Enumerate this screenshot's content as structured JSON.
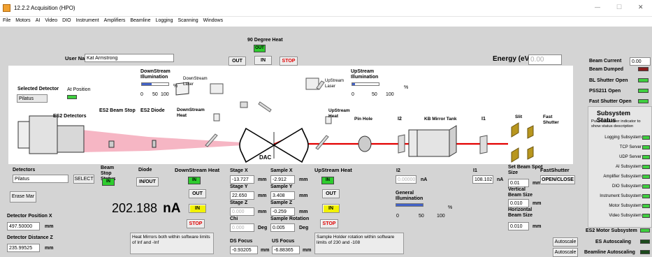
{
  "window": {
    "title": "12.2.2 Acquisition (HPO)",
    "minimize": "—",
    "maximize": "☐",
    "close": "✕"
  },
  "menu": [
    "File",
    "Motors",
    "AI",
    "Video",
    "DIO",
    "Instrument",
    "Amplifiers",
    "Beamline",
    "Logging",
    "Scanning",
    "Windows"
  ],
  "header": {
    "user_name_label": "User Name",
    "user_name": "Kat Armstrong",
    "heat90_label": "90 Degree Heat",
    "heat90_state": "OUT",
    "out": "OUT",
    "in": "IN",
    "stop": "STOP",
    "energy_label": "Energy (eV)",
    "energy_value": "0.00"
  },
  "right_status": {
    "beam_current_label": "Beam Current",
    "beam_current": "0.00",
    "beam_dumped": "Beam Dumped",
    "bl_shutter": "BL Shutter Open",
    "pss211": "PSS211 Open",
    "fast_shutter": "Fast Shutter Open"
  },
  "subsystem": {
    "title": "Subsystem Status",
    "hint": "Put mouse over indicator to show status description",
    "items": [
      "Logging Subsystem",
      "TCP Server",
      "UDP Server",
      "AI Subsystem",
      "Amplifier Subsystem",
      "DIO Subsystem",
      "Instrument Subsystem",
      "Motor Subsystem",
      "Video Subsystem"
    ]
  },
  "bottom_right": {
    "es2_motor": "ES2 Motor Subsystem",
    "es_autoscaling": "ES Autoscaling",
    "bl_autoscaling": "Beamline Autoscaling",
    "autoscale": "Autoscale"
  },
  "diagram": {
    "selected_detector_label": "Selected Detector",
    "selected_detector": "Pilatus",
    "at_position": "At Position",
    "downstream_illumination": "DownStream Illumination",
    "upstream_illumination": "UpStream Illumination",
    "pct": "%",
    "scale": [
      "0",
      "50",
      "100"
    ],
    "downstream_laser": "DownStream Laser",
    "upstream_laser": "UpStream Laser",
    "es2_detectors": "ES2 Detectors",
    "es2_beam_stop": "ES2 Beam Stop",
    "es2_diode": "ES2 Diode",
    "downstream_heat": "DownStream Heat",
    "upstream_heat": "UpStream Heat",
    "pin_hole": "Pin Hole",
    "i2": "I2",
    "kb_mirror_tank": "KB Mirror Tank",
    "i1": "I1",
    "slit": "Slit",
    "fast_shutter": "Fast Shutter",
    "dac": "DAC"
  },
  "controls": {
    "detectors_label": "Detectors",
    "detectors_value": "Pilatus",
    "select": "SELECT",
    "erase_mar": "Erase Mar",
    "det_pos_x_label": "Detector Position X",
    "det_pos_x": "497.50000",
    "mm": "mm",
    "det_dist_z_label": "Detector Distance Z",
    "det_dist_z": "235.99525",
    "beam_stop_label": "Beam Stop Status",
    "beam_stop_state": "IN",
    "diode_label": "Diode",
    "diode_btn": "IN/OUT",
    "current_value": "202.188",
    "current_unit": "nA",
    "ds_heat_label": "DownStream Heat",
    "ds_heat_state": "IN",
    "out": "OUT",
    "in": "IN",
    "stop": "STOP",
    "heat_note": "Heat Mirrors both within software limits of Inf and -Inf",
    "stage_x_label": "Stage X",
    "stage_x": "-13.727",
    "stage_y_label": "Stage Y",
    "stage_y": "22.650",
    "stage_z_label": "Stage Z",
    "stage_z": "0.000",
    "chi_label": "Chi",
    "chi": "0.000",
    "deg": "Deg",
    "ds_focus_label": "DS Focus",
    "ds_focus": "-0.93205",
    "sample_x_label": "Sample X",
    "sample_x": "-2.912",
    "sample_y_label": "Sample Y",
    "sample_y": "3.408",
    "sample_z_label": "Sample Z",
    "sample_z": "-0.259",
    "sample_rot_label": "Sample Rotation",
    "sample_rot": "0.005",
    "us_focus_label": "US Focus",
    "us_focus": "-6.88365",
    "us_heat_label": "UpStream Heat",
    "us_heat_state": "IN",
    "rot_note": "Sample Holder rotation within software limits of 230 and -108",
    "i2_label": "I2",
    "i2_value": "0.00000",
    "na": "nA",
    "general_illum_label": "General Illumination",
    "i1_label": "I1",
    "i1_value": "108.102",
    "beam_spot_label": "Set Beam Spot Size",
    "beam_spot": "0.01",
    "vbeam_label": "Vertical Beam Size",
    "vbeam": "0.010",
    "hbeam_label": "Horizontal Beam Size",
    "hbeam": "0.010",
    "fastshutter_label": "FastShutter",
    "fastshutter_btn": "OPEN/CLOSE"
  },
  "colors": {
    "led_green": "#2ecc2e",
    "led_yellow": "#f2f200",
    "stop_red": "#e00000",
    "beam_pink": "#f6b6c4",
    "beam_red": "#e30000"
  }
}
